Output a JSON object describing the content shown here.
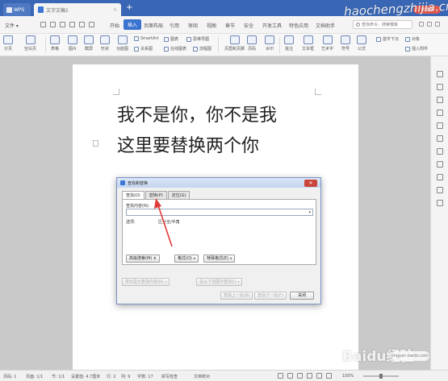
{
  "titlebar": {
    "app_tab": "WPS",
    "doc_tab": "文字文稿1",
    "new_tab": "+",
    "login_badge": "未登录"
  },
  "watermark": {
    "text": "haochengzhijia.cn",
    "baidu": "Baidu经验",
    "baidu_sub": "jingyan.baidu.com"
  },
  "menubar": {
    "file": "文件",
    "items": [
      "开始",
      "插入",
      "页面布局",
      "引用",
      "审阅",
      "视图",
      "章节",
      "安全",
      "开发工具",
      "特色应用",
      "文档助手"
    ],
    "active_index": 1,
    "search": "查找命令、搜索模板"
  },
  "ribbon": {
    "large": [
      "分页",
      "空白页",
      "表格",
      "图片",
      "截屏",
      "形状",
      "功能图",
      "页眉和页脚",
      "页码",
      "水印",
      "批注",
      "文本框",
      "艺术字",
      "符号",
      "公式"
    ],
    "small": [
      "SmartArt",
      "图表",
      "思维导图",
      "关系图",
      "在线图表",
      "流程图",
      "首字下沉",
      "插入附件",
      "对象"
    ]
  },
  "document": {
    "line1": "我不是你，你不是我",
    "line2": "这里要替换两个你"
  },
  "dialog": {
    "title": "查找和替换",
    "tabs": [
      "查找(D)",
      "替换(P)",
      "定位(G)"
    ],
    "find_label": "查找内容(N):",
    "options_label": "选项:",
    "options_value": "区分全/半角",
    "buttons": {
      "highlight": "高级搜索(M) ±",
      "format": "格式(O)",
      "special": "特殊格式(E)",
      "read_highlight": "突出显示查找内容(R)",
      "find_in": "在以下范围中查找(I)",
      "find_prev": "查找上一处(B)",
      "find_next": "查找下一处(F)",
      "close": "关闭"
    }
  },
  "statusbar": {
    "left": [
      "页码: 1",
      "页面: 1/1",
      "节: 1/1",
      "设置值: 4.7厘米",
      "行: 2",
      "列: 9",
      "字数: 17",
      "拼写检查",
      "文档校对"
    ],
    "zoom": "100%"
  },
  "colors": {
    "titlebar": "#3a67b5",
    "accent": "#3a73cf",
    "arrow": "#e03b3b",
    "close": "#c9453a"
  }
}
